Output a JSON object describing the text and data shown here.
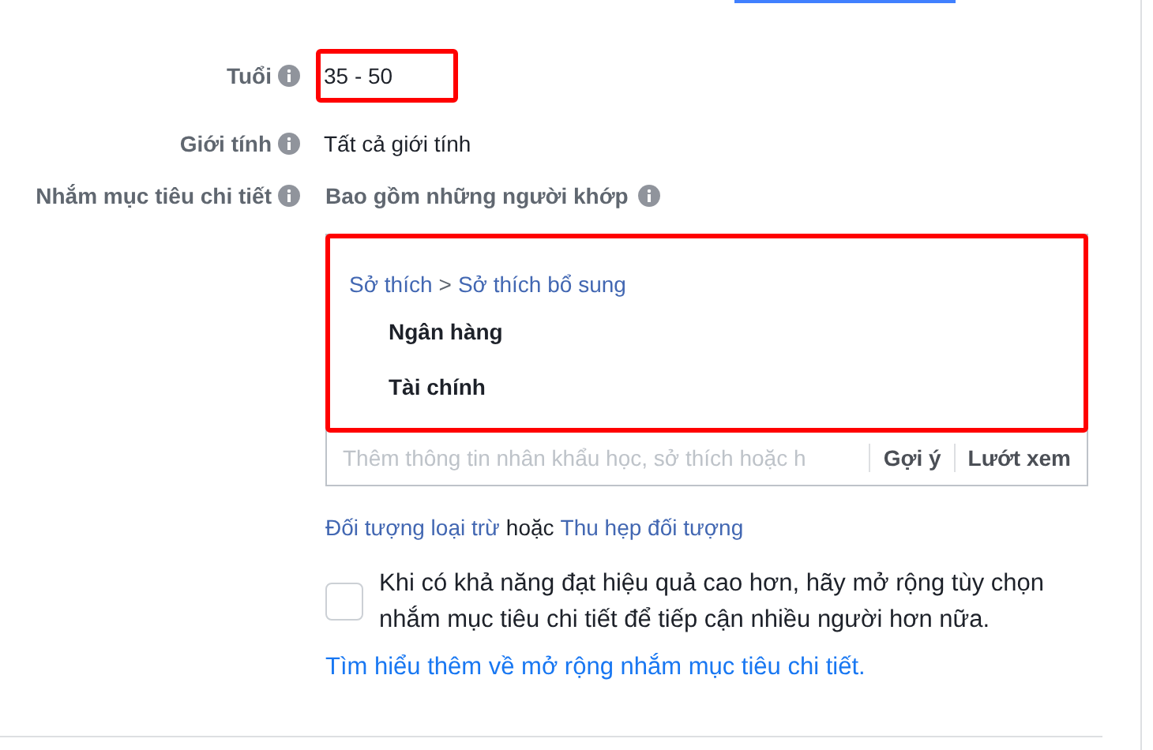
{
  "fields": [
    {
      "kind": "value",
      "label": "Tuổi",
      "value": "35 - 50",
      "highlighted": true
    },
    {
      "kind": "value",
      "label": "Giới tính",
      "value": "Tất cả giới tính",
      "highlighted": false
    },
    {
      "kind": "targeting",
      "label": "Nhắm mục tiêu chi tiết",
      "heading": "Bao gồm những người khớp"
    }
  ],
  "targeting": {
    "highlighted": true,
    "breadcrumb": [
      "Sở thích",
      "Sở thích bổ sung"
    ],
    "breadcrumb_separator": ">",
    "items": [
      "Ngân hàng",
      "Tài chính"
    ],
    "search": {
      "placeholder": "Thêm thông tin nhân khẩu học, sở thích hoặc h"
    },
    "actions": [
      "Gợi ý",
      "Lướt xem"
    ],
    "links": {
      "first": "Đối tượng loại trừ",
      "joiner": "hoặc",
      "second": "Thu hẹp đối tượng"
    },
    "expand": {
      "checked": false,
      "text": "Khi có khả năng đạt hiệu quả cao hơn, hãy mở rộng tùy chọn nhắm mục tiêu chi tiết để tiếp cận nhiều người hơn nữa."
    },
    "learn_more": "Tìm hiểu thêm về mở rộng nhắm mục tiêu chi tiết."
  }
}
